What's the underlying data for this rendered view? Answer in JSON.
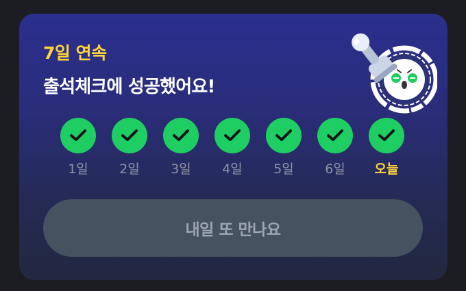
{
  "card": {
    "streak_text": "7일 연속",
    "title": "출석체크에 성공했어요!"
  },
  "days": [
    {
      "label": "1일",
      "checked": true
    },
    {
      "label": "2일",
      "checked": true
    },
    {
      "label": "3일",
      "checked": true
    },
    {
      "label": "4일",
      "checked": true
    },
    {
      "label": "5일",
      "checked": true
    },
    {
      "label": "6일",
      "checked": true
    },
    {
      "label": "오늘",
      "checked": true,
      "today": true
    }
  ],
  "button": {
    "label": "내일 또 만나요"
  },
  "colors": {
    "accent_yellow": "#ffd43b",
    "check_green": "#1fce62",
    "button_bg": "#475260"
  },
  "icons": {
    "stamp": "attendance-stamp-icon",
    "check": "check-icon"
  }
}
